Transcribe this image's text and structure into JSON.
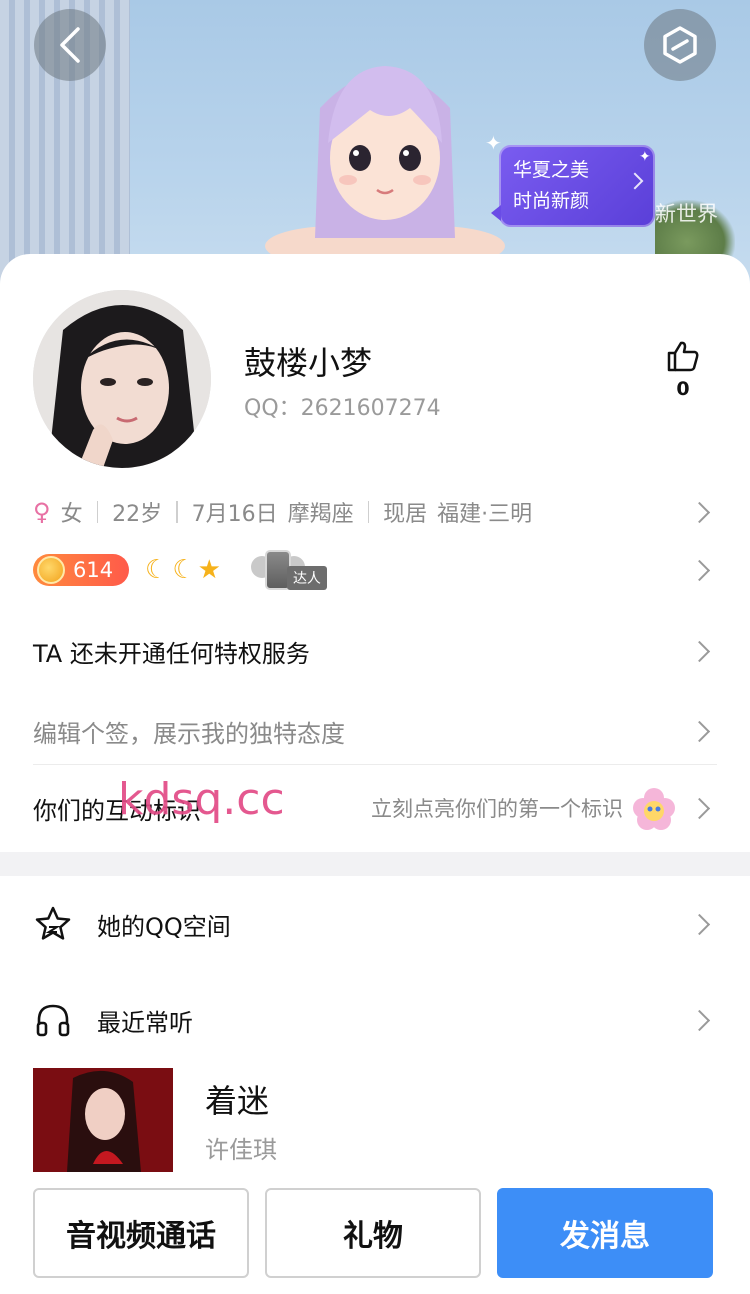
{
  "banner": {
    "promo_line1": "华夏之美",
    "promo_line2": "时尚新颜",
    "world_label": "新世界"
  },
  "profile": {
    "nickname": "鼓楼小梦",
    "qq_label": "QQ：",
    "qq_number": "2621607274",
    "like_count": "0"
  },
  "info": {
    "gender_symbol": "♀",
    "gender": "女",
    "age": "22岁",
    "birthday": "7月16日",
    "zodiac": "摩羯座",
    "residence_label": "现居",
    "residence": "福建·三明"
  },
  "badges": {
    "level": "614",
    "daren_label": "达人"
  },
  "rows": {
    "privilege": "TA 还未开通任何特权服务",
    "signature_placeholder": "编辑个签，展示我的独特态度",
    "interaction_label": "你们的互动标识",
    "interaction_hint": "立刻点亮你们的第一个标识",
    "qzone": "她的QQ空间",
    "recent_music": "最近常听"
  },
  "song": {
    "title": "着迷",
    "artist": "许佳琪"
  },
  "actions": {
    "call": "音视频通话",
    "gift": "礼物",
    "message": "发消息"
  },
  "overlay": {
    "watermark": "kdsq.cc"
  },
  "colors": {
    "primary_blue": "#3d8ef7",
    "promo_purple": "#6a4ce6",
    "level_orange": "#ff6a44",
    "watermark_pink": "#e24a86"
  }
}
